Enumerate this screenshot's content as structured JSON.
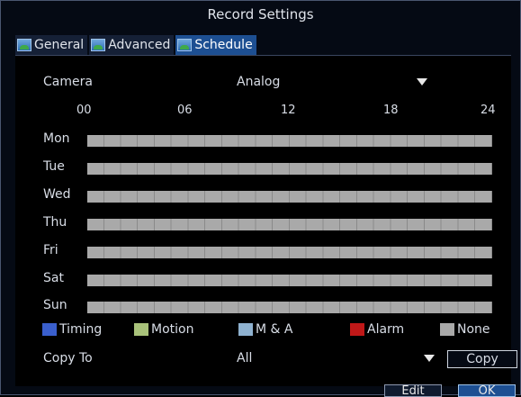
{
  "window": {
    "title": "Record Settings"
  },
  "tabs": [
    {
      "label": "General",
      "active": false
    },
    {
      "label": "Advanced",
      "active": false
    },
    {
      "label": "Schedule",
      "active": true
    }
  ],
  "camera": {
    "label": "Camera",
    "value": "Analog"
  },
  "hours": [
    "00",
    "06",
    "12",
    "18",
    "24"
  ],
  "days": [
    {
      "label": "Mon",
      "mode": "None"
    },
    {
      "label": "Tue",
      "mode": "None"
    },
    {
      "label": "Wed",
      "mode": "None"
    },
    {
      "label": "Thu",
      "mode": "None"
    },
    {
      "label": "Fri",
      "mode": "None"
    },
    {
      "label": "Sat",
      "mode": "None"
    },
    {
      "label": "Sun",
      "mode": "None"
    }
  ],
  "legend": [
    {
      "label": "Timing",
      "color": "#3a5fcd"
    },
    {
      "label": "Motion",
      "color": "#a9c27a"
    },
    {
      "label": "M & A",
      "color": "#8fb2d0"
    },
    {
      "label": "Alarm",
      "color": "#c01818"
    },
    {
      "label": "None",
      "color": "#a9a9a9"
    }
  ],
  "copy_to": {
    "label": "Copy To",
    "value": "All",
    "button_label": "Copy"
  },
  "buttons": {
    "edit_label": "Edit",
    "ok_label": "OK"
  },
  "colors": {
    "accent": "#1d4f92",
    "none_bar": "#a9a9a9",
    "background": "#000000"
  }
}
